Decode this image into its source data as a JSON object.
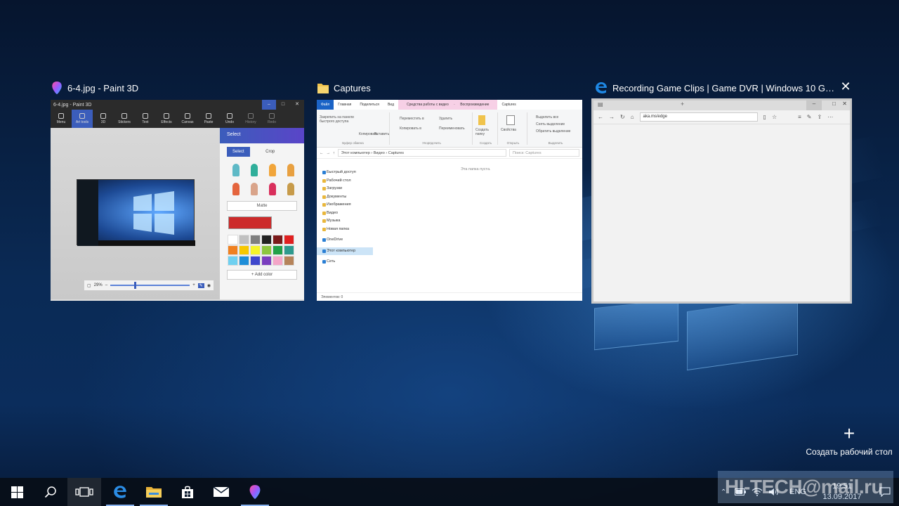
{
  "task_view": {
    "windows": [
      {
        "title": "6-4.jpg - Paint 3D",
        "app": "paint3d",
        "content": {
          "titlebar": "6-4.jpg - Paint 3D",
          "toolbar": [
            "Menu",
            "Art tools",
            "3D",
            "Stickers",
            "Text",
            "Effects",
            "Canvas",
            "Paste",
            "Undo",
            "History",
            "Redo"
          ],
          "active_tool": "Art tools",
          "panel_title": "Select",
          "select_label": "Select",
          "crop_label": "Crop",
          "material": "Matte",
          "zoom": "29%",
          "add_color": "Add color",
          "current_color": "#cc2a2a",
          "palette": [
            "#ffffff",
            "#c0c0c0",
            "#7f7f7f",
            "#222222",
            "#7a1a1a",
            "#e02020",
            "#f08020",
            "#f7c800",
            "#f5f52a",
            "#8dc63f",
            "#21a049",
            "#2d9a8e",
            "#6fd0f0",
            "#1e8ed8",
            "#3f48cc",
            "#7b3fbf",
            "#f4a6c8",
            "#b5835a"
          ]
        }
      },
      {
        "title": "Captures",
        "app": "explorer",
        "content": {
          "ribbon_tabs": [
            "Файл",
            "Главная",
            "Поделиться",
            "Вид",
            "Воспроизведение"
          ],
          "context_tab": "Средства работы с видео",
          "window_label": "Captures",
          "groups": [
            "Буфер обмена",
            "Упорядочить",
            "Создать",
            "Открыть",
            "Выделить"
          ],
          "pin_label": "Закрепить на панели быстрого доступа",
          "copy_label": "Копировать",
          "paste_label": "Вставить",
          "move_label": "Переместить в",
          "copy_to_label": "Копировать в",
          "delete_label": "Удалить",
          "rename_label": "Переименовать",
          "new_folder_label": "Создать папку",
          "properties_label": "Свойства",
          "select_all": "Выделить все",
          "select_none": "Снять выделение",
          "invert_selection": "Обратить выделение",
          "path": "Этот компьютер › Видео › Captures",
          "search_placeholder": "Поиск: Captures",
          "empty_message": "Эта папка пуста.",
          "nav_items": [
            "Быстрый доступ",
            "Рабочий стол",
            "Загрузки",
            "Документы",
            "Изображения",
            "Видео",
            "Музыка",
            "Новая папка",
            "OneDrive",
            "Этот компьютер",
            "Сеть"
          ],
          "selected_nav": "Этот компьютер",
          "status": "Элементов: 0"
        }
      },
      {
        "title": "Recording Game Clips | Game DVR | Windows 10 Games...",
        "app": "edge",
        "content": {
          "url": "aka.ms/edge"
        }
      }
    ],
    "new_desktop_label": "Создать рабочий стол"
  },
  "taskbar": {
    "apps": [
      {
        "name": "start",
        "icon": "windows-logo-icon"
      },
      {
        "name": "search",
        "icon": "search-icon"
      },
      {
        "name": "task-view",
        "icon": "task-view-icon"
      },
      {
        "name": "edge",
        "icon": "edge-icon"
      },
      {
        "name": "explorer",
        "icon": "folder-icon"
      },
      {
        "name": "store",
        "icon": "store-icon"
      },
      {
        "name": "mail",
        "icon": "mail-icon"
      },
      {
        "name": "paint3d",
        "icon": "paint3d-icon"
      }
    ],
    "language": "ENG",
    "time": "19:51",
    "date": "13.09.2017"
  },
  "watermark": "HI-TECH@mail.ru"
}
